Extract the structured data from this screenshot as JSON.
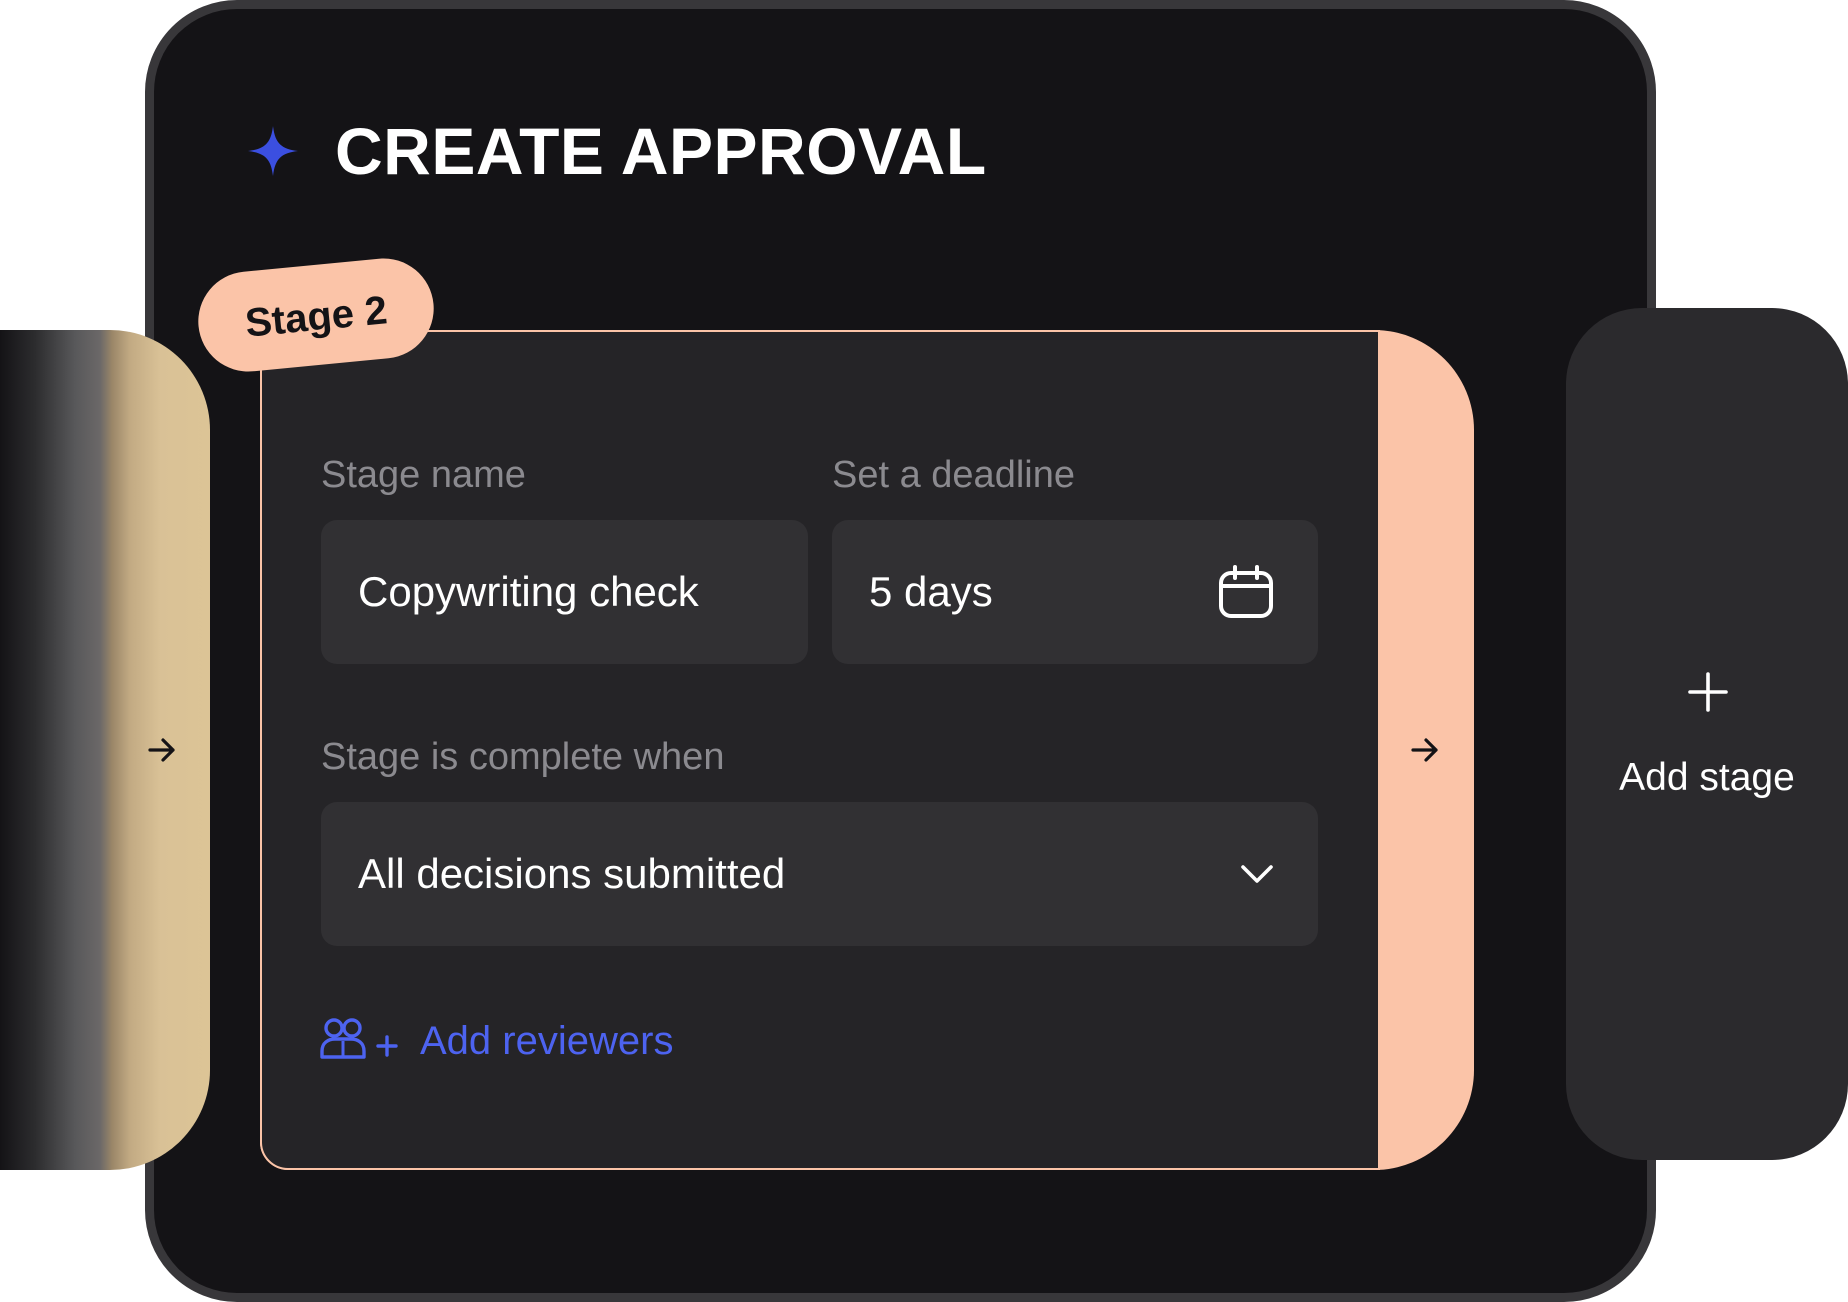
{
  "header": {
    "title": "CREATE APPROVAL",
    "icon": "sparkle-icon",
    "icon_color": "#3b4fe0"
  },
  "stage": {
    "tag": "Stage 2",
    "name_label": "Stage name",
    "name_value": "Copywriting check",
    "deadline_label": "Set a deadline",
    "deadline_value": "5 days",
    "deadline_icon": "calendar-icon",
    "completion_label": "Stage is complete when",
    "completion_value": "All decisions submitted",
    "completion_icon": "chevron-down-icon",
    "add_reviewers_label": "Add reviewers",
    "add_reviewers_icon": "add-users-icon"
  },
  "navigation": {
    "prev_icon": "arrow-right-icon",
    "next_icon": "arrow-right-icon"
  },
  "add_stage": {
    "label": "Add stage",
    "icon": "plus-icon"
  },
  "colors": {
    "background": "#141316",
    "card": "#252427",
    "field": "#313033",
    "accent_peach": "#fbc4a8",
    "accent_tan": "#dcc496",
    "link_blue": "#4d63f0"
  }
}
